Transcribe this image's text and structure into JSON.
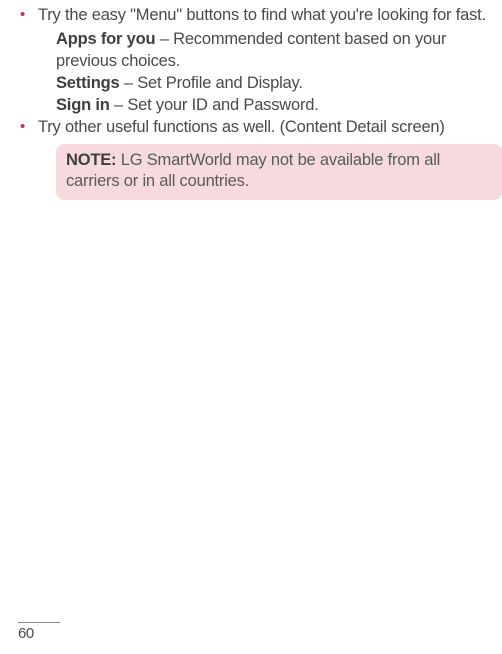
{
  "bullets": [
    {
      "main": "Try the easy \"Menu\" buttons to find what you're looking for fast.",
      "subs": [
        {
          "label": "Apps for you",
          "text": " – Recommended content based on your previous choices."
        },
        {
          "label": "Settings",
          "text": " – Set Profile and Display."
        },
        {
          "label": "Sign in",
          "text": " – Set your ID and Password."
        }
      ]
    },
    {
      "main": "Try other useful functions as well. (Content Detail screen)",
      "subs": []
    }
  ],
  "note": {
    "label": "NOTE:",
    "text": " LG SmartWorld may not be available from all carriers or in all countries."
  },
  "page_number": "60"
}
